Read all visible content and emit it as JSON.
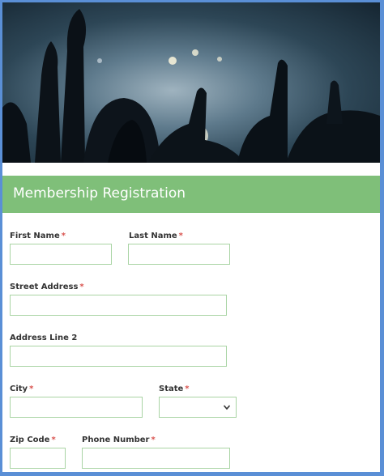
{
  "hero": {
    "image": "concert-crowd"
  },
  "header": {
    "title": "Membership Registration",
    "bg_color": "#7fbf79"
  },
  "form": {
    "required_marker": "*",
    "fields": {
      "first_name": {
        "label": "First Name",
        "required": true,
        "value": ""
      },
      "last_name": {
        "label": "Last Name",
        "required": true,
        "value": ""
      },
      "street_address": {
        "label": "Street Address",
        "required": true,
        "value": ""
      },
      "address_line_2": {
        "label": "Address Line 2",
        "required": false,
        "value": ""
      },
      "city": {
        "label": "City",
        "required": true,
        "value": ""
      },
      "state": {
        "label": "State",
        "required": true,
        "value": ""
      },
      "zip_code": {
        "label": "Zip Code",
        "required": true,
        "value": ""
      },
      "phone_number": {
        "label": "Phone Number",
        "required": true,
        "value": ""
      }
    }
  },
  "colors": {
    "frame": "#5a8fd6",
    "required": "#d9534f",
    "input_border": "#a9d4a4"
  }
}
